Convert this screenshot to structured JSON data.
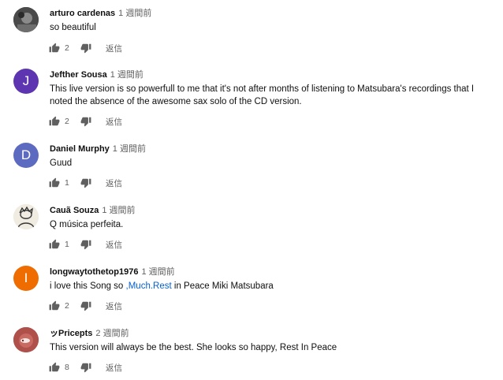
{
  "reply_label": "返信",
  "comments": [
    {
      "author": "arturo cardenas",
      "time": "1 週間前",
      "text": "so beautiful",
      "likes": "2",
      "avatar": {
        "type": "photo-dark",
        "letter": "",
        "color": "#3d3d3d"
      }
    },
    {
      "author": "Jefther Sousa",
      "time": "1 週間前",
      "text": "This live version is so powerfull to me that it's not after months of listening to Matsubara's recordings that I noted the absence of the awesome sax solo of the CD version.",
      "likes": "2",
      "avatar": {
        "type": "letter",
        "letter": "J",
        "color": "#5e35b1"
      }
    },
    {
      "author": "Daniel Murphy",
      "time": "1 週間前",
      "text": "Guud",
      "likes": "1",
      "avatar": {
        "type": "letter",
        "letter": "D",
        "color": "#5c6bc0"
      }
    },
    {
      "author": "Cauã Souza",
      "time": "1 週間前",
      "text": "Q música perfeita.",
      "likes": "1",
      "avatar": {
        "type": "photo-sketch",
        "letter": "",
        "color": "#e8e4d8"
      }
    },
    {
      "author": "longwaytothetop1976",
      "time": "1 週間前",
      "text_before": "i love this Song so ",
      "text_link": ",Much.Rest",
      "text_after": " in Peace Miki Matsubara",
      "likes": "2",
      "avatar": {
        "type": "letter",
        "letter": "I",
        "color": "#ef6c00"
      }
    },
    {
      "author": "ッPricepts",
      "time": "2 週間前",
      "text": "This version will always be the best. She looks so happy, Rest In Peace",
      "likes": "8",
      "avatar": {
        "type": "photo-red",
        "letter": "",
        "color": "#b0504a"
      }
    }
  ]
}
